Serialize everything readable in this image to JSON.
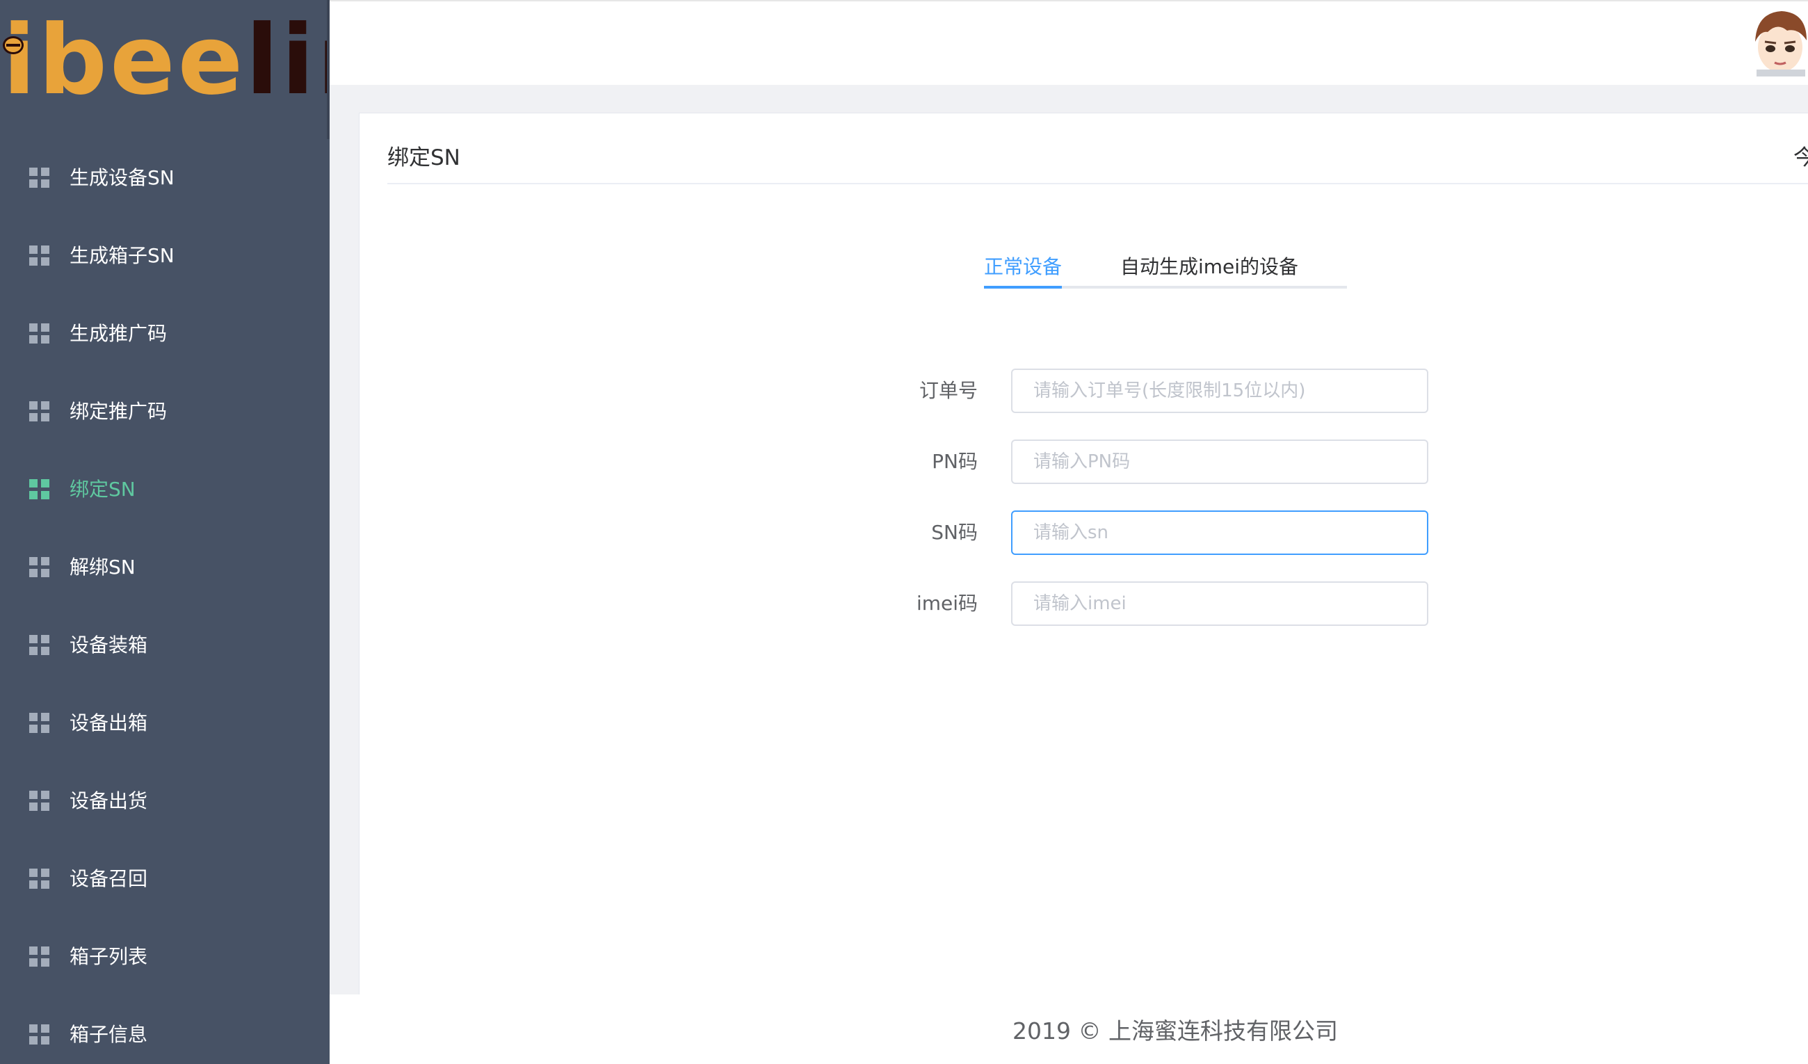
{
  "logo": {
    "part1": "ibee",
    "part2": "link"
  },
  "sidebar": {
    "items": [
      {
        "label": "生成设备SN",
        "icon": "grid-icon",
        "active": false
      },
      {
        "label": "生成箱子SN",
        "icon": "grid-icon",
        "active": false
      },
      {
        "label": "生成推广码",
        "icon": "grid-icon",
        "active": false
      },
      {
        "label": "绑定推广码",
        "icon": "grid-icon",
        "active": false
      },
      {
        "label": "绑定SN",
        "icon": "grid-icon",
        "active": true
      },
      {
        "label": "解绑SN",
        "icon": "grid-icon",
        "active": false
      },
      {
        "label": "设备装箱",
        "icon": "grid-icon",
        "active": false
      },
      {
        "label": "设备出箱",
        "icon": "grid-icon",
        "active": false
      },
      {
        "label": "设备出货",
        "icon": "grid-icon",
        "active": false
      },
      {
        "label": "设备召回",
        "icon": "grid-icon",
        "active": false
      },
      {
        "label": "箱子列表",
        "icon": "grid-icon",
        "active": false
      },
      {
        "label": "箱子信息",
        "icon": "grid-icon",
        "active": false
      }
    ],
    "active_color": "#5fc8a0",
    "background": "#475265"
  },
  "header": {
    "avatar": "user-avatar"
  },
  "card": {
    "title": "绑定SN",
    "extra": "今"
  },
  "tabs": [
    {
      "label": "正常设备",
      "active": true
    },
    {
      "label": "自动生成imei的设备",
      "active": false
    }
  ],
  "form": {
    "fields": [
      {
        "label": "订单号",
        "value": "",
        "placeholder": "请输入订单号(长度限制15位以内)"
      },
      {
        "label": "PN码",
        "value": "",
        "placeholder": "请输入PN码"
      },
      {
        "label": "SN码",
        "value": "",
        "placeholder": "请输入sn",
        "focused": true
      },
      {
        "label": "imei码",
        "value": "",
        "placeholder": "请输入imei"
      }
    ]
  },
  "footer": {
    "text": "2019 © 上海蜜连科技有限公司"
  },
  "colors": {
    "accent": "#409eff",
    "border": "#dcdfe6"
  }
}
